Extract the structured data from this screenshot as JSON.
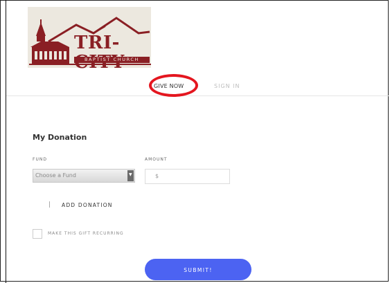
{
  "logo": {
    "title": "TRI-CITY",
    "subtitle": "BAPTIST CHURCH"
  },
  "nav": {
    "give_now": "GIVE NOW",
    "sign_in": "SIGN IN",
    "highlight_color": "#e4161f"
  },
  "donation": {
    "title": "My Donation",
    "fund_label": "FUND",
    "fund_placeholder": "Choose a Fund",
    "amount_label": "AMOUNT",
    "amount_prefix": "$",
    "add_donation": "ADD DONATION",
    "recurring_label": "MAKE THIS GIFT RECURRING",
    "submit": "SUBMIT!"
  },
  "colors": {
    "brand": "#8a1f24",
    "accent": "#4c63f2"
  },
  "icons": {
    "select_arrow": "chevron-down-icon"
  }
}
